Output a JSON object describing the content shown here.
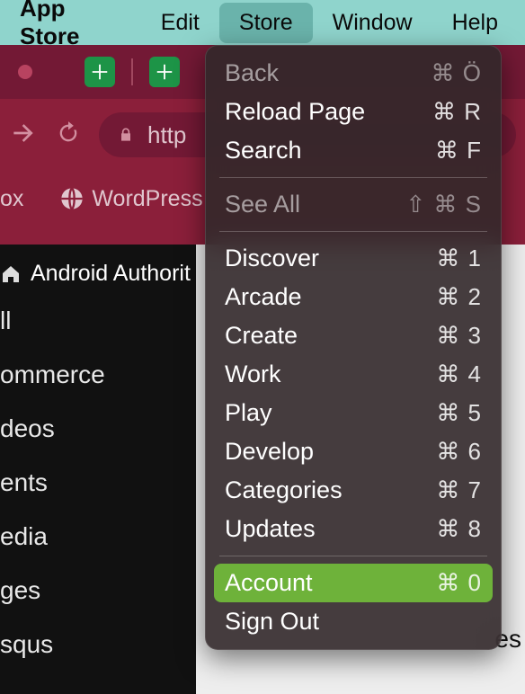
{
  "menubar": {
    "title": "App Store",
    "items": [
      {
        "label": "Edit"
      },
      {
        "label": "Store",
        "active": true
      },
      {
        "label": "Window"
      },
      {
        "label": "Help"
      }
    ]
  },
  "browser": {
    "url_text": "http",
    "bookmarks": {
      "item0": "ox",
      "item1": "WordPress"
    }
  },
  "sidebar": {
    "title": "Android Authorit",
    "items": [
      "ll",
      "ommerce",
      "deos",
      "ents",
      "edia",
      "ges",
      "squs"
    ]
  },
  "content": {
    "bottom_text": "es"
  },
  "dropdown": {
    "group1": [
      {
        "label": "Back",
        "shortcut": "⌘ Ö",
        "enabled": false
      },
      {
        "label": "Reload Page",
        "shortcut": "⌘ R",
        "enabled": true
      },
      {
        "label": "Search",
        "shortcut": "⌘ F",
        "enabled": true
      }
    ],
    "group2": [
      {
        "label": "See All",
        "shortcut": "⇧ ⌘ S",
        "enabled": false
      }
    ],
    "group3": [
      {
        "label": "Discover",
        "shortcut": "⌘ 1",
        "enabled": true
      },
      {
        "label": "Arcade",
        "shortcut": "⌘ 2",
        "enabled": true
      },
      {
        "label": "Create",
        "shortcut": "⌘ 3",
        "enabled": true
      },
      {
        "label": "Work",
        "shortcut": "⌘ 4",
        "enabled": true
      },
      {
        "label": "Play",
        "shortcut": "⌘ 5",
        "enabled": true
      },
      {
        "label": "Develop",
        "shortcut": "⌘ 6",
        "enabled": true
      },
      {
        "label": "Categories",
        "shortcut": "⌘ 7",
        "enabled": true
      },
      {
        "label": "Updates",
        "shortcut": "⌘ 8",
        "enabled": true
      }
    ],
    "group4": [
      {
        "label": "Account",
        "shortcut": "⌘ 0",
        "enabled": true,
        "highlight": true
      },
      {
        "label": "Sign Out",
        "shortcut": "",
        "enabled": true
      }
    ]
  }
}
